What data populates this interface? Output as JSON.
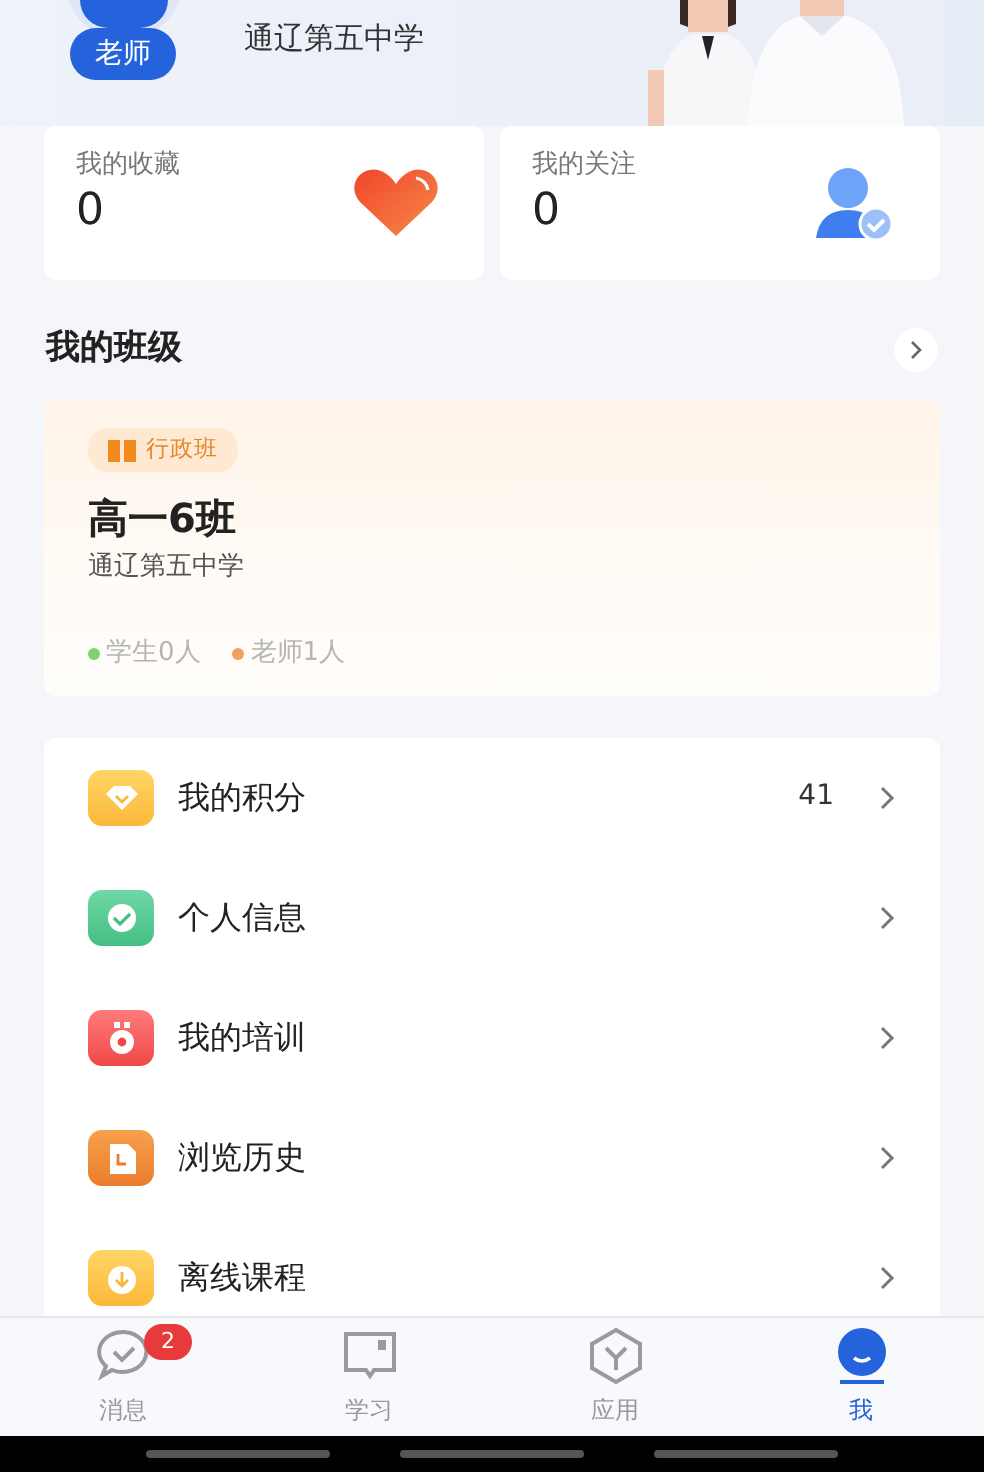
{
  "profile": {
    "role_badge": "老师",
    "school": "通辽第五中学"
  },
  "stats": [
    {
      "kind": "favorites",
      "label": "我的收藏",
      "value": "0"
    },
    {
      "kind": "following",
      "label": "我的关注",
      "value": "0"
    }
  ],
  "my_class": {
    "title": "我的班级",
    "card": {
      "tag": "行政班",
      "name": "高一6班",
      "school": "通辽第五中学",
      "members": [
        {
          "text": "学生0人",
          "color": "#7ed36a"
        },
        {
          "text": "老师1人",
          "color": "#f5a05a"
        }
      ]
    }
  },
  "menu": [
    {
      "kind": "points",
      "label": "我的积分",
      "value": "41"
    },
    {
      "kind": "profile",
      "label": "个人信息"
    },
    {
      "kind": "training",
      "label": "我的培训"
    },
    {
      "kind": "history",
      "label": "浏览历史"
    },
    {
      "kind": "offline",
      "label": "离线课程"
    }
  ],
  "tab_bar": [
    {
      "kind": "messages",
      "label": "消息",
      "badge": "2",
      "selected": false
    },
    {
      "kind": "study",
      "label": "学习",
      "selected": false
    },
    {
      "kind": "apps",
      "label": "应用",
      "selected": false
    },
    {
      "kind": "me",
      "label": "我",
      "selected": true
    }
  ]
}
